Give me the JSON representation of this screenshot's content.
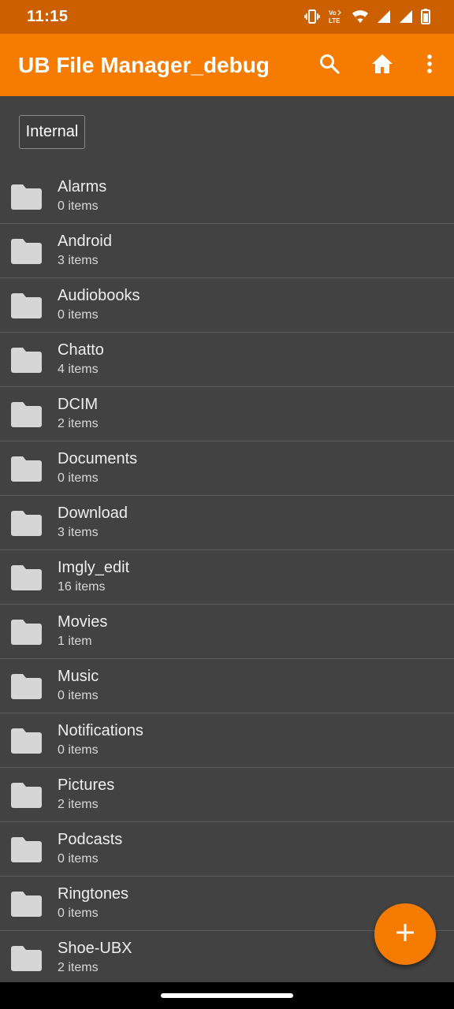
{
  "status_bar": {
    "time": "11:15",
    "icons": [
      "vibrate-icon",
      "volte-icon",
      "wifi-icon",
      "signal-icon",
      "signal-icon",
      "battery-icon"
    ]
  },
  "app_bar": {
    "title": "UB File Manager_debug",
    "actions": [
      "search-icon",
      "home-icon",
      "more-vert-icon"
    ],
    "color": "#f57c00"
  },
  "storage": {
    "label": "Internal"
  },
  "folders": [
    {
      "name": "Alarms",
      "count": "0 items"
    },
    {
      "name": "Android",
      "count": "3 items"
    },
    {
      "name": "Audiobooks",
      "count": "0 items"
    },
    {
      "name": "Chatto",
      "count": "4 items"
    },
    {
      "name": "DCIM",
      "count": "2 items"
    },
    {
      "name": "Documents",
      "count": "0 items"
    },
    {
      "name": "Download",
      "count": "3 items"
    },
    {
      "name": "Imgly_edit",
      "count": "16 items"
    },
    {
      "name": "Movies",
      "count": "1 item"
    },
    {
      "name": "Music",
      "count": "0 items"
    },
    {
      "name": "Notifications",
      "count": "0 items"
    },
    {
      "name": "Pictures",
      "count": "2 items"
    },
    {
      "name": "Podcasts",
      "count": "0 items"
    },
    {
      "name": "Ringtones",
      "count": "0 items"
    },
    {
      "name": "Shoe-UBX",
      "count": "2 items"
    }
  ],
  "fab": {
    "icon": "plus-icon"
  }
}
